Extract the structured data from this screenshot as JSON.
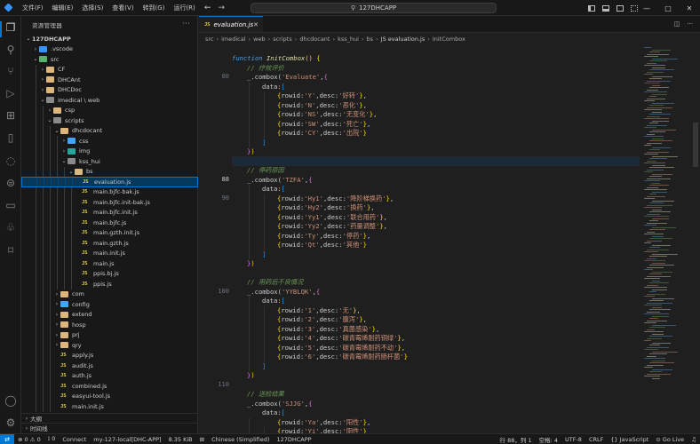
{
  "menu": [
    "文件(F)",
    "编辑(E)",
    "选择(S)",
    "查看(V)",
    "转到(G)",
    "运行(R)",
    "···"
  ],
  "nav": {
    "back": "←",
    "forward": "→"
  },
  "search": {
    "label": "127DHCAPP"
  },
  "window_controls": {
    "minimize": "—",
    "maximize": "□",
    "close": "✕"
  },
  "sidebar": {
    "title": "资源管理器",
    "more": "···",
    "items": [
      {
        "label": "127DHCAPP",
        "depth": 0,
        "chev": "⌄",
        "icon": "none"
      },
      {
        "label": ".vscode",
        "depth": 1,
        "chev": "›",
        "icon": "folder-vscode"
      },
      {
        "label": "src",
        "depth": 1,
        "chev": "⌄",
        "icon": "folder-src"
      },
      {
        "label": "CF",
        "depth": 2,
        "chev": "›",
        "icon": "folder"
      },
      {
        "label": "DHCAnt",
        "depth": 2,
        "chev": "›",
        "icon": "folder"
      },
      {
        "label": "DHCDoc",
        "depth": 2,
        "chev": "›",
        "icon": "folder"
      },
      {
        "label": "imedical \\ web",
        "depth": 2,
        "chev": "⌄",
        "icon": "folder-grey"
      },
      {
        "label": "csp",
        "depth": 3,
        "chev": "›",
        "icon": "folder"
      },
      {
        "label": "scripts",
        "depth": 3,
        "chev": "⌄",
        "icon": "folder-grey"
      },
      {
        "label": "dhcdocant",
        "depth": 4,
        "chev": "⌄",
        "icon": "folder"
      },
      {
        "label": "css",
        "depth": 5,
        "chev": "›",
        "icon": "folder-blue"
      },
      {
        "label": "img",
        "depth": 5,
        "chev": "›",
        "icon": "folder-teal"
      },
      {
        "label": "kss_hui",
        "depth": 5,
        "chev": "⌄",
        "icon": "folder-grey"
      },
      {
        "label": "bs",
        "depth": 6,
        "chev": "⌄",
        "icon": "folder"
      },
      {
        "label": "evaluation.js",
        "depth": 7,
        "chev": "",
        "icon": "js",
        "selected": true
      },
      {
        "label": "main.bjfc-bak.js",
        "depth": 7,
        "chev": "",
        "icon": "js"
      },
      {
        "label": "main.bjfc.init-bak.js",
        "depth": 7,
        "chev": "",
        "icon": "js"
      },
      {
        "label": "main.bjfc.init.js",
        "depth": 7,
        "chev": "",
        "icon": "js"
      },
      {
        "label": "main.bjfc.js",
        "depth": 7,
        "chev": "",
        "icon": "js"
      },
      {
        "label": "main.gzth.init.js",
        "depth": 7,
        "chev": "",
        "icon": "js"
      },
      {
        "label": "main.gzth.js",
        "depth": 7,
        "chev": "",
        "icon": "js"
      },
      {
        "label": "main.init.js",
        "depth": 7,
        "chev": "",
        "icon": "js"
      },
      {
        "label": "main.js",
        "depth": 7,
        "chev": "",
        "icon": "js"
      },
      {
        "label": "ppis.bj.js",
        "depth": 7,
        "chev": "",
        "icon": "js"
      },
      {
        "label": "ppis.js",
        "depth": 7,
        "chev": "",
        "icon": "js"
      },
      {
        "label": "com",
        "depth": 4,
        "chev": "›",
        "icon": "folder"
      },
      {
        "label": "config",
        "depth": 4,
        "chev": "›",
        "icon": "folder-blue"
      },
      {
        "label": "extend",
        "depth": 4,
        "chev": "›",
        "icon": "folder"
      },
      {
        "label": "hosp",
        "depth": 4,
        "chev": "›",
        "icon": "folder"
      },
      {
        "label": "prj",
        "depth": 4,
        "chev": "›",
        "icon": "folder"
      },
      {
        "label": "qry",
        "depth": 4,
        "chev": "›",
        "icon": "folder"
      },
      {
        "label": "apply.js",
        "depth": 4,
        "chev": "",
        "icon": "js"
      },
      {
        "label": "audit.js",
        "depth": 4,
        "chev": "",
        "icon": "js"
      },
      {
        "label": "auth.js",
        "depth": 4,
        "chev": "",
        "icon": "js"
      },
      {
        "label": "combined.js",
        "depth": 4,
        "chev": "",
        "icon": "js"
      },
      {
        "label": "easyui-tool.js",
        "depth": 4,
        "chev": "",
        "icon": "js"
      },
      {
        "label": "main.init.js",
        "depth": 4,
        "chev": "",
        "icon": "js"
      }
    ],
    "outline": "大纲",
    "timeline": "时间线"
  },
  "tab": {
    "file_type": "JS",
    "label": "evaluation.js",
    "close": "✕"
  },
  "breadcrumb": [
    "src",
    "imedical",
    "web",
    "scripts",
    "dhcdocant",
    "kss_hui",
    "bs",
    "JS evaluation.js",
    "InitCombox"
  ],
  "editor": {
    "line_numbers": [
      {
        "line": 0,
        "text": "80"
      },
      {
        "line": 11,
        "text": "88",
        "active": true
      },
      {
        "line": 13,
        "text": "90"
      },
      {
        "line": 23,
        "text": "100"
      },
      {
        "line": 33,
        "text": "110"
      }
    ],
    "cursor_line": 11,
    "lines": [
      {
        "indent": 0,
        "tokens": [
          [
            "kw",
            "function "
          ],
          [
            "fn",
            "InitCombox"
          ],
          [
            "p1",
            "()"
          ],
          [
            "prop",
            " "
          ],
          [
            "p1",
            "{"
          ]
        ]
      },
      {
        "indent": 1,
        "tokens": [
          [
            "cm",
            "// 疗效评价"
          ]
        ]
      },
      {
        "indent": 1,
        "tokens": [
          [
            "prop",
            "_.combox("
          ],
          [
            "str",
            "'Evaluate'"
          ],
          [
            "prop",
            ","
          ],
          [
            "p2",
            "{"
          ]
        ]
      },
      {
        "indent": 2,
        "tokens": [
          [
            "prop",
            "data:"
          ],
          [
            "p3",
            "["
          ]
        ]
      },
      {
        "indent": 3,
        "tokens": [
          [
            "p1",
            "{"
          ],
          [
            "prop",
            "rowid:"
          ],
          [
            "str",
            "'Y'"
          ],
          [
            "prop",
            ",desc:"
          ],
          [
            "str",
            "'好转'"
          ],
          [
            "p1",
            "}"
          ],
          [
            "prop",
            ","
          ]
        ]
      },
      {
        "indent": 3,
        "tokens": [
          [
            "p1",
            "{"
          ],
          [
            "prop",
            "rowid:"
          ],
          [
            "str",
            "'N'"
          ],
          [
            "prop",
            ",desc:"
          ],
          [
            "str",
            "'恶化'"
          ],
          [
            "p1",
            "}"
          ],
          [
            "prop",
            ","
          ]
        ]
      },
      {
        "indent": 3,
        "tokens": [
          [
            "p1",
            "{"
          ],
          [
            "prop",
            "rowid:"
          ],
          [
            "str",
            "'NS'"
          ],
          [
            "prop",
            ",desc:"
          ],
          [
            "str",
            "'无变化'"
          ],
          [
            "p1",
            "}"
          ],
          [
            "prop",
            ","
          ]
        ]
      },
      {
        "indent": 3,
        "tokens": [
          [
            "p1",
            "{"
          ],
          [
            "prop",
            "rowid:"
          ],
          [
            "str",
            "'SW'"
          ],
          [
            "prop",
            ",desc:"
          ],
          [
            "str",
            "'死亡'"
          ],
          [
            "p1",
            "}"
          ],
          [
            "prop",
            ","
          ]
        ]
      },
      {
        "indent": 3,
        "tokens": [
          [
            "p1",
            "{"
          ],
          [
            "prop",
            "rowid:"
          ],
          [
            "str",
            "'CY'"
          ],
          [
            "prop",
            ",desc:"
          ],
          [
            "str",
            "'出院'"
          ],
          [
            "p1",
            "}"
          ]
        ]
      },
      {
        "indent": 2,
        "tokens": [
          [
            "p3",
            "]"
          ]
        ]
      },
      {
        "indent": 1,
        "tokens": [
          [
            "p2",
            "}"
          ],
          [
            "p1",
            ")"
          ]
        ]
      },
      {
        "indent": 0,
        "tokens": []
      },
      {
        "indent": 1,
        "tokens": [
          [
            "cm",
            "// 停药原因"
          ]
        ]
      },
      {
        "indent": 1,
        "tokens": [
          [
            "prop",
            "_.combox("
          ],
          [
            "str",
            "'TZFA'"
          ],
          [
            "prop",
            ","
          ],
          [
            "p2",
            "{"
          ]
        ]
      },
      {
        "indent": 2,
        "tokens": [
          [
            "prop",
            "data:"
          ],
          [
            "p3",
            "["
          ]
        ]
      },
      {
        "indent": 3,
        "tokens": [
          [
            "p1",
            "{"
          ],
          [
            "prop",
            "rowid:"
          ],
          [
            "str",
            "'Hy1'"
          ],
          [
            "prop",
            ",desc:"
          ],
          [
            "str",
            "'降阶梯换药'"
          ],
          [
            "p1",
            "}"
          ],
          [
            "prop",
            ","
          ]
        ]
      },
      {
        "indent": 3,
        "tokens": [
          [
            "p1",
            "{"
          ],
          [
            "prop",
            "rowid:"
          ],
          [
            "str",
            "'Hy2'"
          ],
          [
            "prop",
            ",desc:"
          ],
          [
            "str",
            "'换药'"
          ],
          [
            "p1",
            "}"
          ],
          [
            "prop",
            ","
          ]
        ]
      },
      {
        "indent": 3,
        "tokens": [
          [
            "p1",
            "{"
          ],
          [
            "prop",
            "rowid:"
          ],
          [
            "str",
            "'Yy1'"
          ],
          [
            "prop",
            ",desc:"
          ],
          [
            "str",
            "'联合用药'"
          ],
          [
            "p1",
            "}"
          ],
          [
            "prop",
            ","
          ]
        ]
      },
      {
        "indent": 3,
        "tokens": [
          [
            "p1",
            "{"
          ],
          [
            "prop",
            "rowid:"
          ],
          [
            "str",
            "'Yy2'"
          ],
          [
            "prop",
            ",desc:"
          ],
          [
            "str",
            "'药量调整'"
          ],
          [
            "p1",
            "}"
          ],
          [
            "prop",
            ","
          ]
        ]
      },
      {
        "indent": 3,
        "tokens": [
          [
            "p1",
            "{"
          ],
          [
            "prop",
            "rowid:"
          ],
          [
            "str",
            "'Ty'"
          ],
          [
            "prop",
            ",desc:"
          ],
          [
            "str",
            "'停药'"
          ],
          [
            "p1",
            "}"
          ],
          [
            "prop",
            ","
          ]
        ]
      },
      {
        "indent": 3,
        "tokens": [
          [
            "p1",
            "{"
          ],
          [
            "prop",
            "rowid:"
          ],
          [
            "str",
            "'Qt'"
          ],
          [
            "prop",
            ",desc:"
          ],
          [
            "str",
            "'其他'"
          ],
          [
            "p1",
            "}"
          ]
        ]
      },
      {
        "indent": 2,
        "tokens": [
          [
            "p3",
            "]"
          ]
        ]
      },
      {
        "indent": 1,
        "tokens": [
          [
            "p2",
            "}"
          ],
          [
            "p1",
            ")"
          ]
        ]
      },
      {
        "indent": 0,
        "tokens": []
      },
      {
        "indent": 1,
        "tokens": [
          [
            "cm",
            "// 用药后不良情况"
          ]
        ]
      },
      {
        "indent": 1,
        "tokens": [
          [
            "prop",
            "_.combox("
          ],
          [
            "str",
            "'YYBLQK'"
          ],
          [
            "prop",
            ","
          ],
          [
            "p2",
            "{"
          ]
        ]
      },
      {
        "indent": 2,
        "tokens": [
          [
            "prop",
            "data:"
          ],
          [
            "p3",
            "["
          ]
        ]
      },
      {
        "indent": 3,
        "tokens": [
          [
            "p1",
            "{"
          ],
          [
            "prop",
            "rowid:"
          ],
          [
            "str",
            "'1'"
          ],
          [
            "prop",
            ",desc:"
          ],
          [
            "str",
            "'无'"
          ],
          [
            "p1",
            "}"
          ],
          [
            "prop",
            ","
          ]
        ]
      },
      {
        "indent": 3,
        "tokens": [
          [
            "p1",
            "{"
          ],
          [
            "prop",
            "rowid:"
          ],
          [
            "str",
            "'2'"
          ],
          [
            "prop",
            ",desc:"
          ],
          [
            "str",
            "'腹泻'"
          ],
          [
            "p1",
            "}"
          ],
          [
            "prop",
            ","
          ]
        ]
      },
      {
        "indent": 3,
        "tokens": [
          [
            "p1",
            "{"
          ],
          [
            "prop",
            "rowid:"
          ],
          [
            "str",
            "'3'"
          ],
          [
            "prop",
            ",desc:"
          ],
          [
            "str",
            "'真菌感染'"
          ],
          [
            "p1",
            "}"
          ],
          [
            "prop",
            ","
          ]
        ]
      },
      {
        "indent": 3,
        "tokens": [
          [
            "p1",
            "{"
          ],
          [
            "prop",
            "rowid:"
          ],
          [
            "str",
            "'4'"
          ],
          [
            "prop",
            ",desc:"
          ],
          [
            "str",
            "'碳青霉烯耐药铜绿'"
          ],
          [
            "p1",
            "}"
          ],
          [
            "prop",
            ","
          ]
        ]
      },
      {
        "indent": 3,
        "tokens": [
          [
            "p1",
            "{"
          ],
          [
            "prop",
            "rowid:"
          ],
          [
            "str",
            "'5'"
          ],
          [
            "prop",
            ",desc:"
          ],
          [
            "str",
            "'碳青霉烯耐药不动'"
          ],
          [
            "p1",
            "}"
          ],
          [
            "prop",
            ","
          ]
        ]
      },
      {
        "indent": 3,
        "tokens": [
          [
            "p1",
            "{"
          ],
          [
            "prop",
            "rowid:"
          ],
          [
            "str",
            "'6'"
          ],
          [
            "prop",
            ",desc:"
          ],
          [
            "str",
            "'碳青霉烯耐药肠杆菌'"
          ],
          [
            "p1",
            "}"
          ]
        ]
      },
      {
        "indent": 2,
        "tokens": [
          [
            "p3",
            "]"
          ]
        ]
      },
      {
        "indent": 1,
        "tokens": [
          [
            "p2",
            "}"
          ],
          [
            "p1",
            ")"
          ]
        ]
      },
      {
        "indent": 0,
        "tokens": []
      },
      {
        "indent": 1,
        "tokens": [
          [
            "cm",
            "// 送检结果"
          ]
        ]
      },
      {
        "indent": 1,
        "tokens": [
          [
            "prop",
            "_.combox("
          ],
          [
            "str",
            "'SJJG'"
          ],
          [
            "prop",
            ","
          ],
          [
            "p2",
            "{"
          ]
        ]
      },
      {
        "indent": 2,
        "tokens": [
          [
            "prop",
            "data:"
          ],
          [
            "p3",
            "["
          ]
        ]
      },
      {
        "indent": 3,
        "tokens": [
          [
            "p1",
            "{"
          ],
          [
            "prop",
            "rowid:"
          ],
          [
            "str",
            "'Ya'"
          ],
          [
            "prop",
            ",desc:"
          ],
          [
            "str",
            "'阳性'"
          ],
          [
            "p1",
            "}"
          ],
          [
            "prop",
            ","
          ]
        ]
      },
      {
        "indent": 3,
        "tokens": [
          [
            "p1",
            "{"
          ],
          [
            "prop",
            "rowid:"
          ],
          [
            "str",
            "'Yi'"
          ],
          [
            "prop",
            ",desc:"
          ],
          [
            "str",
            "'阴性'"
          ],
          [
            "p1",
            "}"
          ]
        ]
      }
    ]
  },
  "statusbar": {
    "remote": "⇄",
    "problems": "⊗ 0 ⚠ 0",
    "ports": "⟟ 0",
    "connect": "Connect",
    "server": "my-127-local[DHC-APP]",
    "memory": "8.35 KiB",
    "lang_icon": "⊞",
    "lang_pack": "Chinese (Simplified)",
    "folder": "127DHCAPP",
    "position": "行 88，列 1",
    "spaces": "空格: 4",
    "encoding": "UTF-8",
    "eol": "CRLF",
    "language": "{} JavaScript",
    "golive": "⊙ Go Live",
    "bell": "♫"
  },
  "colors": {
    "accent": "#0078d4",
    "selected_bg": "#04395e"
  }
}
